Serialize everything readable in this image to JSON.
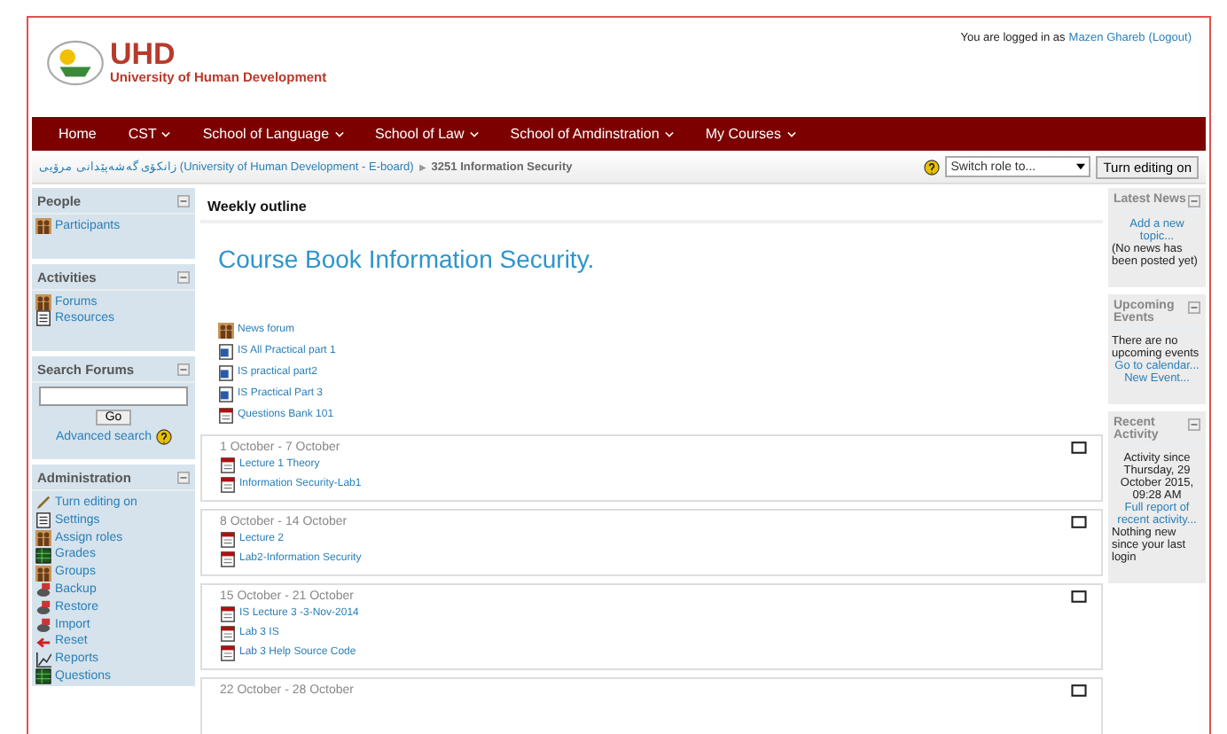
{
  "header": {
    "logo_title": "UHD",
    "logo_subtitle": "University of Human Development",
    "login_prefix": "You are logged in as",
    "user": "Mazen Ghareb",
    "logout": "(Logout)"
  },
  "nav": [
    {
      "label": "Home",
      "dropdown": false
    },
    {
      "label": "CST",
      "dropdown": true
    },
    {
      "label": "School of Language",
      "dropdown": true
    },
    {
      "label": "School of Law",
      "dropdown": true
    },
    {
      "label": "School of Amdinstration",
      "dropdown": true
    },
    {
      "label": "My Courses",
      "dropdown": true
    }
  ],
  "breadcrumb": {
    "parent": "زانکۆی گەشەپێدانی مرۆیی (University of Human Development - E-board)",
    "separator": "▶",
    "current": "3251 Information Security"
  },
  "role_select": {
    "value": "Switch role to..."
  },
  "edit_button": "Turn editing on",
  "left_blocks": [
    {
      "title": "People",
      "items": [
        {
          "label": "Participants",
          "kind": "people"
        }
      ]
    },
    {
      "title": "Activities",
      "items": [
        {
          "label": "Forums",
          "kind": "people"
        },
        {
          "label": "Resources",
          "kind": "page"
        }
      ]
    }
  ],
  "search_forums": {
    "title": "Search Forums",
    "button": "Go",
    "advanced": "Advanced search"
  },
  "administration": {
    "title": "Administration",
    "items": [
      {
        "label": "Turn editing on",
        "kind": "pen"
      },
      {
        "label": "Settings",
        "kind": "page"
      },
      {
        "label": "Assign roles",
        "kind": "people"
      },
      {
        "label": "Grades",
        "kind": "grid"
      },
      {
        "label": "Groups",
        "kind": "people"
      },
      {
        "label": "Backup",
        "kind": "disk"
      },
      {
        "label": "Restore",
        "kind": "disk"
      },
      {
        "label": "Import",
        "kind": "disk"
      },
      {
        "label": "Reset",
        "kind": "arrow"
      },
      {
        "label": "Reports",
        "kind": "chart"
      },
      {
        "label": "Questions",
        "kind": "grid"
      }
    ]
  },
  "main": {
    "heading": "Weekly outline",
    "course_title": "Course Book Information Security.",
    "resources": [
      {
        "label": "News forum",
        "kind": "forum"
      },
      {
        "label": "IS All Practical part 1",
        "kind": "word"
      },
      {
        "label": "IS practical part2",
        "kind": "word"
      },
      {
        "label": "IS Practical Part 3",
        "kind": "word"
      },
      {
        "label": "Questions Bank 101",
        "kind": "pdf"
      }
    ],
    "weeks": [
      {
        "dates": "1 October - 7 October",
        "items": [
          {
            "label": "Lecture 1 Theory",
            "kind": "pdf"
          },
          {
            "label": "Information Security-Lab1",
            "kind": "pdf"
          }
        ]
      },
      {
        "dates": "8 October - 14 October",
        "items": [
          {
            "label": "Lecture 2",
            "kind": "pdf"
          },
          {
            "label": "Lab2-Information Security",
            "kind": "pdf"
          }
        ]
      },
      {
        "dates": "15 October - 21 October",
        "items": [
          {
            "label": "IS Lecture 3 -3-Nov-2014",
            "kind": "pdf"
          },
          {
            "label": "Lab 3 IS",
            "kind": "pdf"
          },
          {
            "label": "Lab 3 Help Source Code",
            "kind": "pdf"
          }
        ]
      },
      {
        "dates": "22 October - 28 October"
      }
    ]
  },
  "right_blocks": [
    {
      "title": "Latest News",
      "lines": [
        {
          "text": "Add a new topic...",
          "kind": "link"
        },
        {
          "text": "(No news has been posted yet)",
          "kind": "text"
        }
      ]
    },
    {
      "title": "Upcoming Events",
      "lines": [
        {
          "text": "There are no upcoming events",
          "kind": "text"
        },
        {
          "text": "Go to calendar...",
          "kind": "link"
        },
        {
          "text": "New Event...",
          "kind": "link"
        }
      ]
    },
    {
      "title": "Recent Activity",
      "lines": [
        {
          "text": "Activity since Thursday, 29 October 2015, 09:28 AM",
          "kind": "centered"
        },
        {
          "text": "Full report of recent activity...",
          "kind": "link"
        },
        {
          "text": "Nothing new since your last login",
          "kind": "text"
        }
      ]
    }
  ]
}
